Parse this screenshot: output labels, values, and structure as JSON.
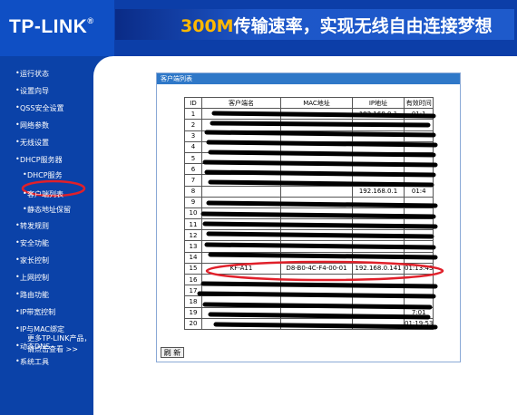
{
  "logo": {
    "text": "TP-LINK",
    "reg": "®"
  },
  "banner": {
    "highlight": "300M",
    "rest": "传输速率，实现无线自由连接梦想"
  },
  "sidebar": {
    "items": [
      {
        "label": "运行状态",
        "sub": false
      },
      {
        "label": "设置向导",
        "sub": false
      },
      {
        "label": "QSS安全设置",
        "sub": false
      },
      {
        "label": "网络参数",
        "sub": false
      },
      {
        "label": "无线设置",
        "sub": false
      },
      {
        "label": "DHCP服务器",
        "sub": false
      },
      {
        "label": "DHCP服务",
        "sub": true
      },
      {
        "label": "客户端列表",
        "sub": true
      },
      {
        "label": "静态地址保留",
        "sub": true
      },
      {
        "label": "转发规则",
        "sub": false
      },
      {
        "label": "安全功能",
        "sub": false
      },
      {
        "label": "家长控制",
        "sub": false
      },
      {
        "label": "上网控制",
        "sub": false
      },
      {
        "label": "路由功能",
        "sub": false
      },
      {
        "label": "IP带宽控制",
        "sub": false
      },
      {
        "label": "IP与MAC绑定",
        "sub": false
      },
      {
        "label": "动态DNS",
        "sub": false
      },
      {
        "label": "系统工具",
        "sub": false
      }
    ],
    "more_line1": "更多TP-LINK产品，",
    "more_line2": "请点击查看 >>"
  },
  "panel": {
    "title": "客户端列表"
  },
  "table": {
    "headers": {
      "id": "ID",
      "name": "客户端名",
      "mac": "MAC地址",
      "ip": "IP地址",
      "time": "有效时间"
    },
    "rows": [
      {
        "id": "1",
        "name": "",
        "mac": "",
        "ip": "192.168.0.1",
        "time": "01:1"
      },
      {
        "id": "2",
        "name": "",
        "mac": "",
        "ip": "",
        "time": ""
      },
      {
        "id": "3",
        "name": "",
        "mac": "",
        "ip": "",
        "time": ""
      },
      {
        "id": "4",
        "name": "",
        "mac": "",
        "ip": "",
        "time": ""
      },
      {
        "id": "5",
        "name": "",
        "mac": "",
        "ip": "",
        "time": ""
      },
      {
        "id": "6",
        "name": "",
        "mac": "",
        "ip": "",
        "time": ""
      },
      {
        "id": "7",
        "name": "",
        "mac": "",
        "ip": "",
        "time": ""
      },
      {
        "id": "8",
        "name": "",
        "mac": "",
        "ip": "192.168.0.1",
        "time": "01:4"
      },
      {
        "id": "9",
        "name": "",
        "mac": "",
        "ip": "",
        "time": ""
      },
      {
        "id": "10",
        "name": "",
        "mac": "",
        "ip": "",
        "time": ""
      },
      {
        "id": "11",
        "name": "",
        "mac": "",
        "ip": "",
        "time": ""
      },
      {
        "id": "12",
        "name": "",
        "mac": "",
        "ip": "",
        "time": ""
      },
      {
        "id": "13",
        "name": "",
        "mac": "",
        "ip": "",
        "time": ""
      },
      {
        "id": "14",
        "name": "",
        "mac": "",
        "ip": "",
        "time": ""
      },
      {
        "id": "15",
        "name": "KF-A11",
        "mac": "D8-B0-4C-F4-00-01",
        "ip": "192.168.0.141",
        "time": "01:13:43"
      },
      {
        "id": "16",
        "name": "",
        "mac": "",
        "ip": "",
        "time": ""
      },
      {
        "id": "17",
        "name": "",
        "mac": "",
        "ip": "",
        "time": ""
      },
      {
        "id": "18",
        "name": "",
        "mac": "",
        "ip": "",
        "time": ""
      },
      {
        "id": "19",
        "name": "",
        "mac": "",
        "ip": "",
        "time": "7:01"
      },
      {
        "id": "20",
        "name": "",
        "mac": "",
        "ip": "",
        "time": "01:19:53"
      }
    ]
  },
  "refresh_label": "刷 新",
  "colors": {
    "header": "#0c3ea8",
    "sidebar": "#0b42a8",
    "panel_title": "#2f78c8",
    "annotation": "#e0202a"
  }
}
